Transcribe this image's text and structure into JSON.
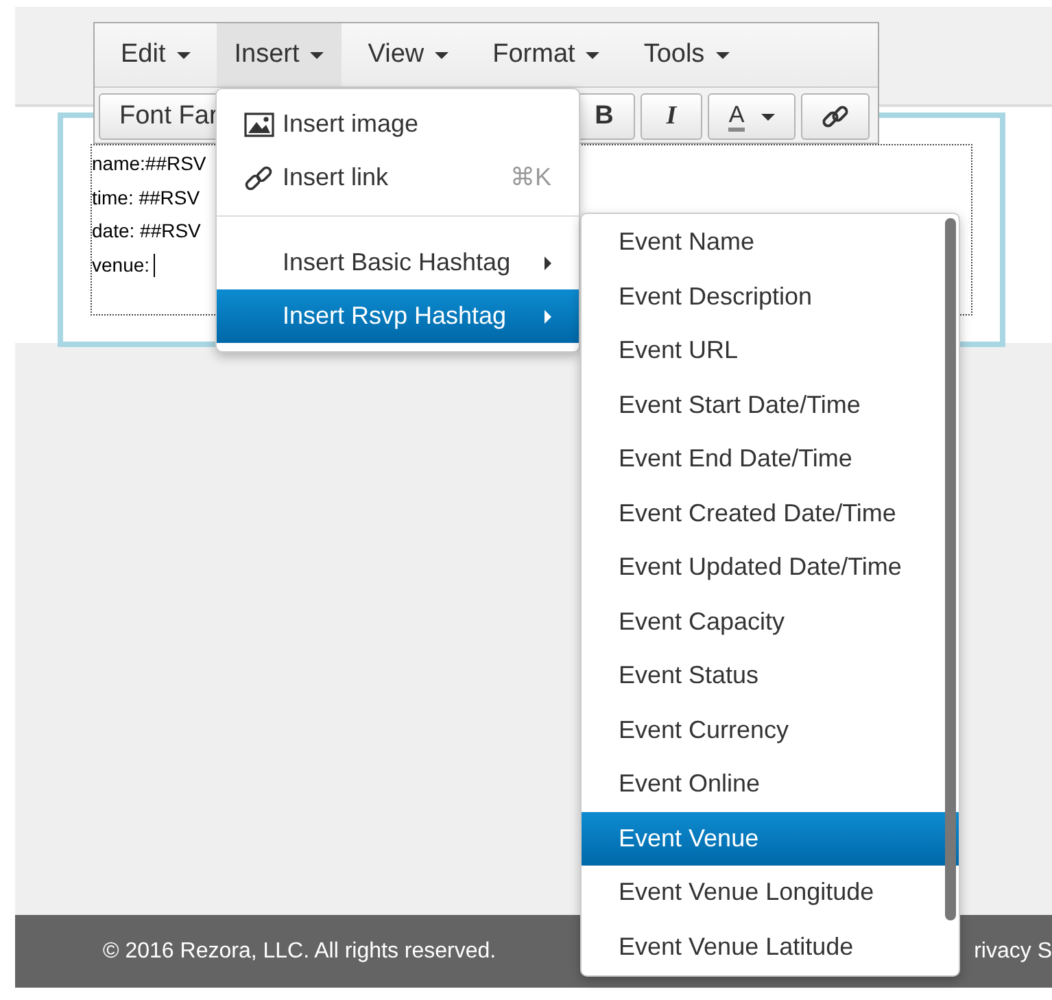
{
  "menubar": [
    {
      "label": "Edit",
      "selected": false
    },
    {
      "label": "Insert",
      "selected": true
    },
    {
      "label": "View",
      "selected": false
    },
    {
      "label": "Format",
      "selected": false
    },
    {
      "label": "Tools",
      "selected": false
    }
  ],
  "toolbar": {
    "font_family": "Font Far",
    "buttons": [
      {
        "kind": "bold",
        "label": "B"
      },
      {
        "kind": "italic",
        "label": "I"
      },
      {
        "kind": "color",
        "label": "A"
      },
      {
        "kind": "link"
      }
    ]
  },
  "editor": {
    "lines": [
      "name:##RSV",
      "time: ##RSV",
      "date: ##RSV",
      "venue:"
    ]
  },
  "insert_menu": {
    "groups": [
      [
        {
          "kind": "image",
          "label": "Insert image",
          "selected": false
        },
        {
          "kind": "link",
          "label": "Insert link",
          "shortcut": "⌘K",
          "selected": false
        }
      ],
      [
        {
          "kind": "submenu",
          "label": "Insert Basic Hashtag",
          "selected": false
        },
        {
          "kind": "submenu",
          "label": "Insert Rsvp Hashtag",
          "selected": true
        }
      ]
    ]
  },
  "rsvp_submenu": [
    {
      "label": "Event Name",
      "selected": false
    },
    {
      "label": "Event Description",
      "selected": false
    },
    {
      "label": "Event URL",
      "selected": false
    },
    {
      "label": "Event Start Date/Time",
      "selected": false
    },
    {
      "label": "Event End Date/Time",
      "selected": false
    },
    {
      "label": "Event Created Date/Time",
      "selected": false
    },
    {
      "label": "Event Updated Date/Time",
      "selected": false
    },
    {
      "label": "Event Capacity",
      "selected": false
    },
    {
      "label": "Event Status",
      "selected": false
    },
    {
      "label": "Event Currency",
      "selected": false
    },
    {
      "label": "Event Online",
      "selected": false
    },
    {
      "label": "Event Venue",
      "selected": true
    },
    {
      "label": "Event Venue Longitude",
      "selected": false
    },
    {
      "label": "Event Venue Latitude",
      "selected": false
    }
  ],
  "footer": {
    "copyright": "© 2016 Rezora, LLC. All rights reserved.",
    "link": "rivacy S"
  }
}
